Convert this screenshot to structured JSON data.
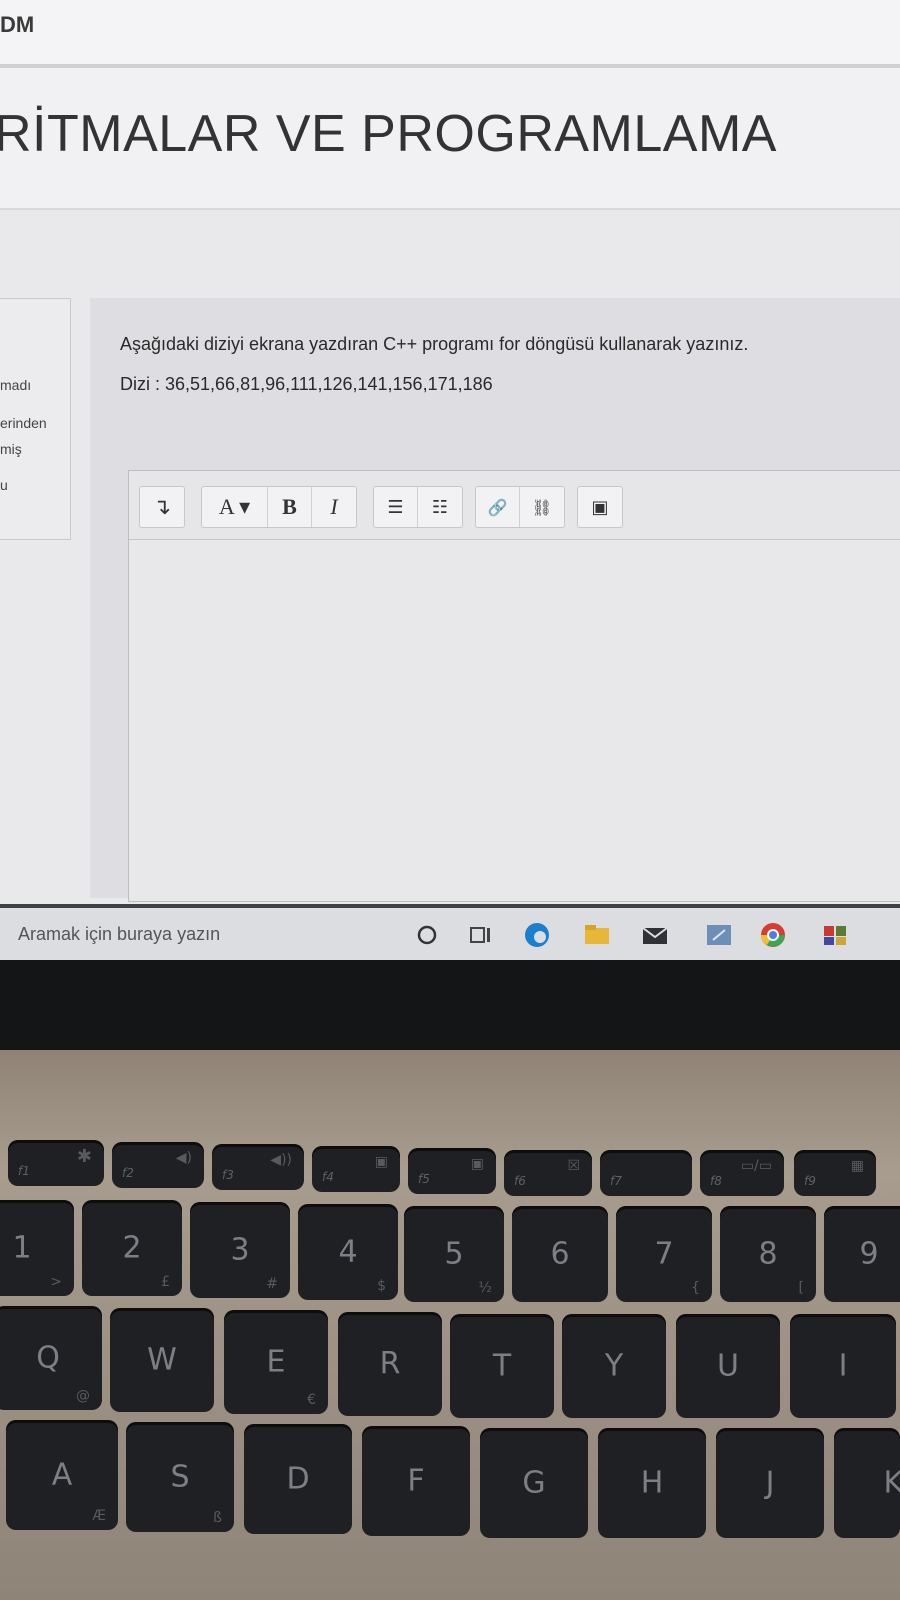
{
  "header": {
    "brand_fragment": "DM"
  },
  "course": {
    "title": "RİTMALAR VE PROGRAMLAMA"
  },
  "left_panel": {
    "fragments": [
      "madı",
      "erinden",
      "miş",
      "u"
    ]
  },
  "question": {
    "prompt": "Aşağıdaki diziyi ekrana yazdıran C++ programı for döngüsü kullanarak yazınız.",
    "sequence": "Dizi : 36,51,66,81,96,111,126,141,156,171,186"
  },
  "editor_toolbar": {
    "expand": "↴",
    "paragraph": "A ▾",
    "bold": "B",
    "italic": "I",
    "bullet_list": "☰",
    "numbered_list": "☷",
    "link": "🔗",
    "unlink": "⛓",
    "image": "▣"
  },
  "taskbar": {
    "search_placeholder": "Aramak için buraya yazın",
    "icons": [
      "cortana-icon",
      "task-view-icon",
      "edge-icon",
      "file-explorer-icon",
      "mail-icon",
      "store-icon",
      "chrome-icon",
      "app-icon"
    ]
  },
  "keyboard": {
    "function_row": [
      {
        "fn": "f1",
        "sym": "✱"
      },
      {
        "fn": "f2",
        "sym": "◀)"
      },
      {
        "fn": "f3",
        "sym": "◀))"
      },
      {
        "fn": "f4",
        "sym": "▣"
      },
      {
        "fn": "f5",
        "sym": "▣"
      },
      {
        "fn": "f6",
        "sym": "☒"
      },
      {
        "fn": "f7",
        "sym": ""
      },
      {
        "fn": "f8",
        "sym": "▭/▭"
      },
      {
        "fn": "f9",
        "sym": "▦"
      }
    ],
    "number_row": [
      {
        "main": "1",
        "sub": ">"
      },
      {
        "main": "2",
        "sub": "£"
      },
      {
        "main": "3",
        "sub": "#"
      },
      {
        "main": "4",
        "sub": "$"
      },
      {
        "main": "5",
        "sub": "½"
      },
      {
        "main": "6",
        "sub": ""
      },
      {
        "main": "7",
        "sub": "{"
      },
      {
        "main": "8",
        "sub": "["
      },
      {
        "main": "9",
        "sub": ""
      }
    ],
    "qwerty_row": [
      {
        "main": "Q",
        "sub": "@"
      },
      {
        "main": "W",
        "sub": ""
      },
      {
        "main": "E",
        "sub": "€"
      },
      {
        "main": "R",
        "sub": ""
      },
      {
        "main": "T",
        "sub": ""
      },
      {
        "main": "Y",
        "sub": ""
      },
      {
        "main": "U",
        "sub": ""
      },
      {
        "main": "I",
        "sub": ""
      }
    ],
    "asdf_row": [
      {
        "main": "A",
        "sub": "Æ"
      },
      {
        "main": "S",
        "sub": "ß"
      },
      {
        "main": "D",
        "sub": ""
      },
      {
        "main": "F",
        "sub": ""
      },
      {
        "main": "G",
        "sub": ""
      },
      {
        "main": "H",
        "sub": ""
      },
      {
        "main": "J",
        "sub": ""
      },
      {
        "main": "K",
        "sub": ""
      }
    ]
  }
}
